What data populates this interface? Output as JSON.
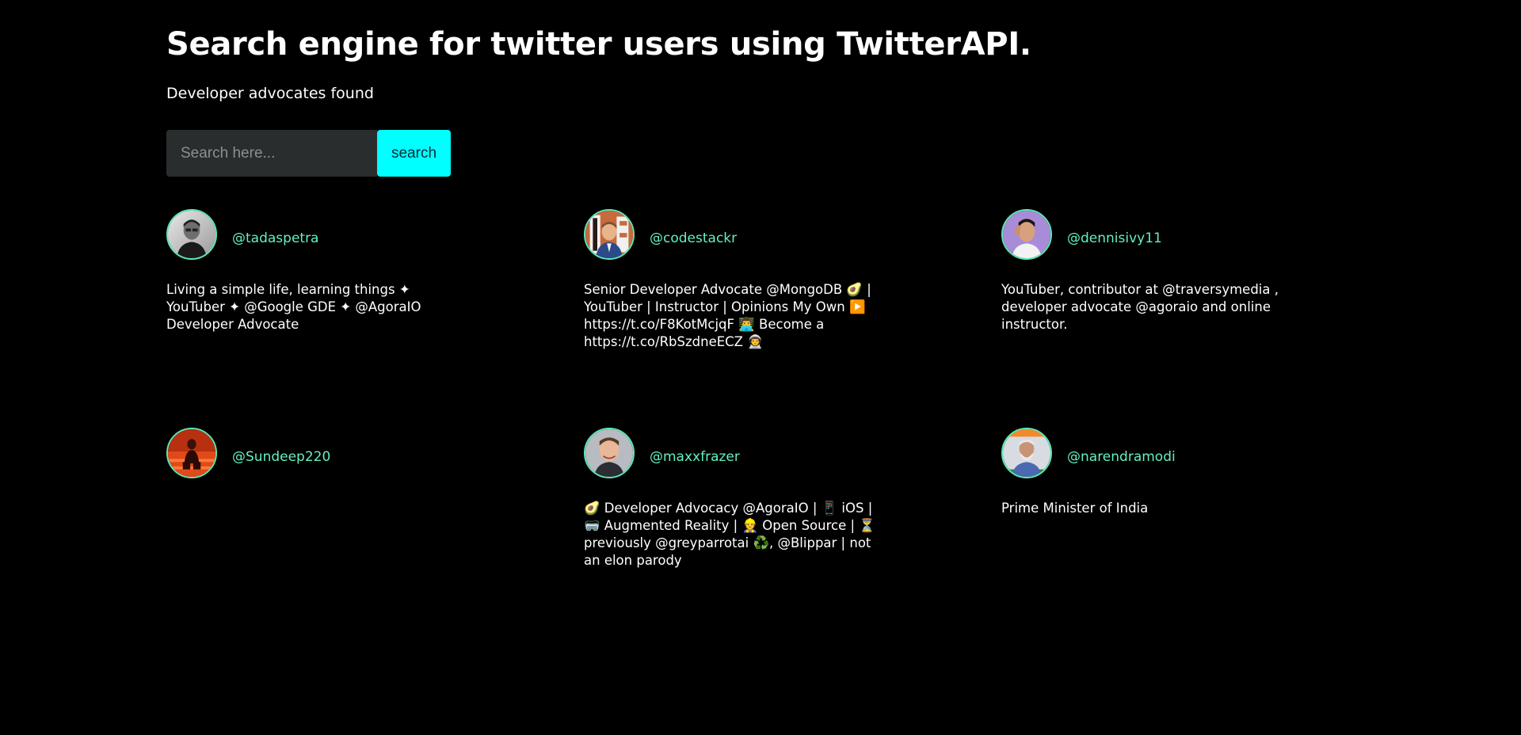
{
  "header": {
    "title": "Search engine for twitter users using TwitterAPI.",
    "subtitle": "Developer advocates found"
  },
  "search": {
    "placeholder": "Search here...",
    "button_label": "search"
  },
  "colors": {
    "background": "#000000",
    "accent_button": "#00ffff",
    "handle": "#64f0c0",
    "avatar_border": "#5ee6b8"
  },
  "users": [
    {
      "handle": "@tadaspetra",
      "bio": "Living a simple life, learning things ✦ YouTuber ✦ @Google GDE ✦ @AgoraIO Developer Advocate"
    },
    {
      "handle": "@codestackr",
      "bio": "Senior Developer Advocate @MongoDB 🥑 | YouTuber | Instructor | Opinions My Own ▶️ https://t.co/F8KotMcjqF 👨‍💻 Become a https://t.co/RbSzdneECZ 👨‍🚀"
    },
    {
      "handle": "@dennisivy11",
      "bio": "YouTuber, contributor at @traversymedia , developer advocate @agoraio and online instructor."
    },
    {
      "handle": "@Sundeep220",
      "bio": ""
    },
    {
      "handle": "@maxxfrazer",
      "bio": "🥑 Developer Advocacy @AgoraIO | 📱 iOS | 🥽 Augmented Reality | 👷 Open Source | ⏳ previously @greyparrotai ♻️, @Blippar | not an elon parody"
    },
    {
      "handle": "@narendramodi",
      "bio": "Prime Minister of India"
    }
  ]
}
